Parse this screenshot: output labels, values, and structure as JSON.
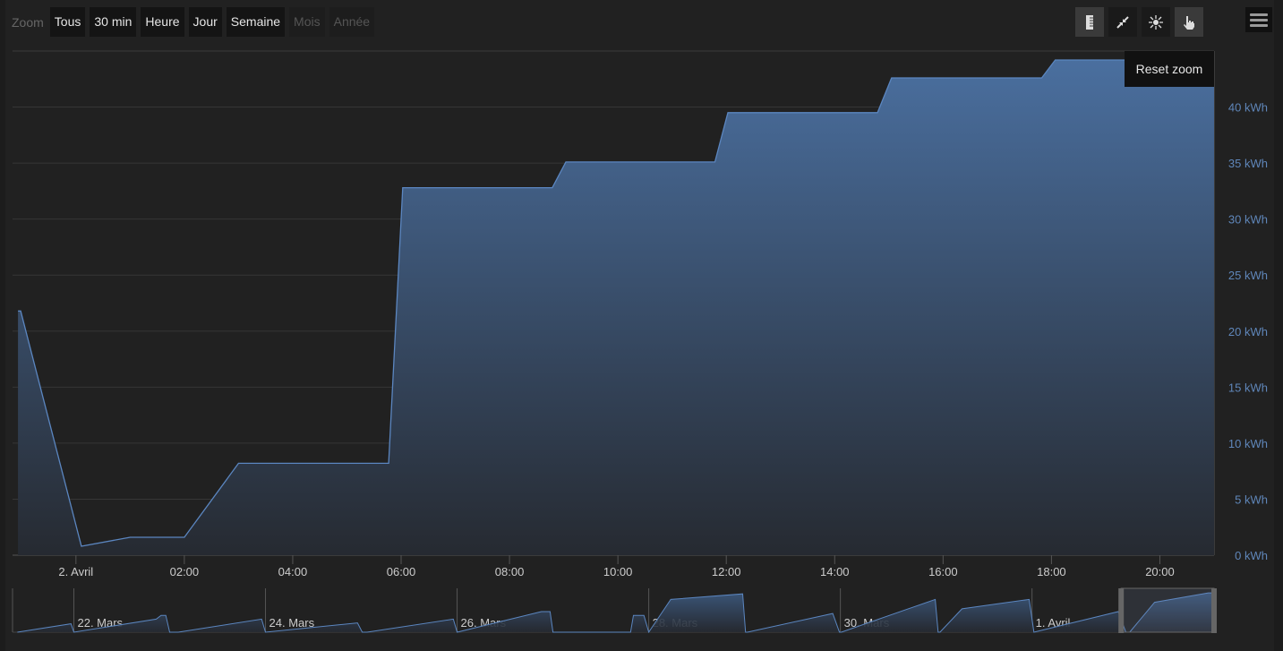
{
  "range_selector": {
    "label": "Zoom",
    "buttons": [
      {
        "label": "Tous",
        "enabled": true
      },
      {
        "label": "30 min",
        "enabled": true
      },
      {
        "label": "Heure",
        "enabled": true
      },
      {
        "label": "Jour",
        "enabled": true
      },
      {
        "label": "Semaine",
        "enabled": true
      },
      {
        "label": "Mois",
        "enabled": false
      },
      {
        "label": "Année",
        "enabled": false
      }
    ]
  },
  "toolbar": {
    "icons": [
      "ruler-icon",
      "collapse-icon",
      "sun-icon",
      "hand-pointer-icon"
    ],
    "menu_icon": "hamburger-menu-icon"
  },
  "tooltip": {
    "text": "Reset zoom"
  },
  "colors": {
    "series": "#5b86c0",
    "fill_top": "#4a6f9f",
    "fill_bottom": "#262a31",
    "axis_label": "#5f86b9"
  },
  "chart_data": {
    "type": "area",
    "title": "",
    "xlabel": "",
    "ylabel": "",
    "x_unit": "hours since 2. Avril 00:00",
    "xlim": [
      -1.17,
      21.0
    ],
    "ylim": [
      0,
      45
    ],
    "grid": true,
    "y_ticks": [
      0,
      5,
      10,
      15,
      20,
      25,
      30,
      35,
      40
    ],
    "y_tick_labels": [
      "0 kWh",
      "5 kWh",
      "10 kWh",
      "15 kWh",
      "20 kWh",
      "25 kWh",
      "30 kWh",
      "35 kWh",
      "40 kWh"
    ],
    "x_ticks": [
      0,
      2,
      4,
      6,
      8,
      10,
      12,
      14,
      16,
      18,
      20
    ],
    "x_tick_labels": [
      "2. Avril",
      "02:00",
      "04:00",
      "06:00",
      "08:00",
      "10:00",
      "12:00",
      "14:00",
      "16:00",
      "18:00",
      "20:00"
    ],
    "series": [
      {
        "name": "energy",
        "points": [
          [
            -1.07,
            21.8
          ],
          [
            -1.02,
            21.8
          ],
          [
            0.1,
            0.8
          ],
          [
            1.0,
            1.6
          ],
          [
            2.0,
            1.6
          ],
          [
            3.0,
            8.2
          ],
          [
            5.77,
            8.2
          ],
          [
            6.03,
            32.8
          ],
          [
            8.79,
            32.8
          ],
          [
            9.04,
            35.1
          ],
          [
            11.79,
            35.1
          ],
          [
            12.03,
            39.5
          ],
          [
            14.79,
            39.5
          ],
          [
            15.05,
            42.6
          ],
          [
            17.82,
            42.6
          ],
          [
            18.07,
            44.2
          ],
          [
            21.0,
            44.2
          ]
        ]
      }
    ],
    "navigator": {
      "x_unit": "days since 22. Mars",
      "xlim": [
        -0.64,
        11.9
      ],
      "ylim": [
        0,
        45
      ],
      "selection": [
        10.93,
        11.9
      ],
      "tick_days": [
        0,
        2,
        4,
        6,
        8,
        10
      ],
      "tick_labels": [
        "22. Mars",
        "24. Mars",
        "26. Mars",
        "28. Mars",
        "30. Mars",
        "1. Avril"
      ],
      "points": [
        [
          -0.59,
          0
        ],
        [
          -0.03,
          9
        ],
        [
          0,
          0
        ],
        [
          0.86,
          14
        ],
        [
          0.91,
          18
        ],
        [
          0.96,
          18
        ],
        [
          1.0,
          0
        ],
        [
          1.09,
          0
        ],
        [
          1.96,
          14
        ],
        [
          2.0,
          0
        ],
        [
          2.96,
          10
        ],
        [
          3.01,
          0
        ],
        [
          3.06,
          0
        ],
        [
          3.96,
          14
        ],
        [
          4.0,
          0
        ],
        [
          4.88,
          22
        ],
        [
          4.97,
          22
        ],
        [
          5.0,
          0
        ],
        [
          5.81,
          0
        ],
        [
          5.84,
          18
        ],
        [
          5.95,
          18
        ],
        [
          6.0,
          0
        ],
        [
          6.23,
          35
        ],
        [
          6.98,
          41
        ],
        [
          7.01,
          0
        ],
        [
          7.03,
          0
        ],
        [
          7.92,
          20
        ],
        [
          7.99,
          0
        ],
        [
          8.01,
          0
        ],
        [
          8.99,
          35
        ],
        [
          9.02,
          0
        ],
        [
          9.04,
          0
        ],
        [
          9.27,
          25
        ],
        [
          9.97,
          35
        ],
        [
          10.02,
          0
        ],
        [
          10.9,
          22
        ],
        [
          10.98,
          0
        ],
        [
          11.02,
          0
        ],
        [
          11.28,
          32
        ],
        [
          11.84,
          42
        ],
        [
          11.9,
          42
        ]
      ]
    }
  }
}
